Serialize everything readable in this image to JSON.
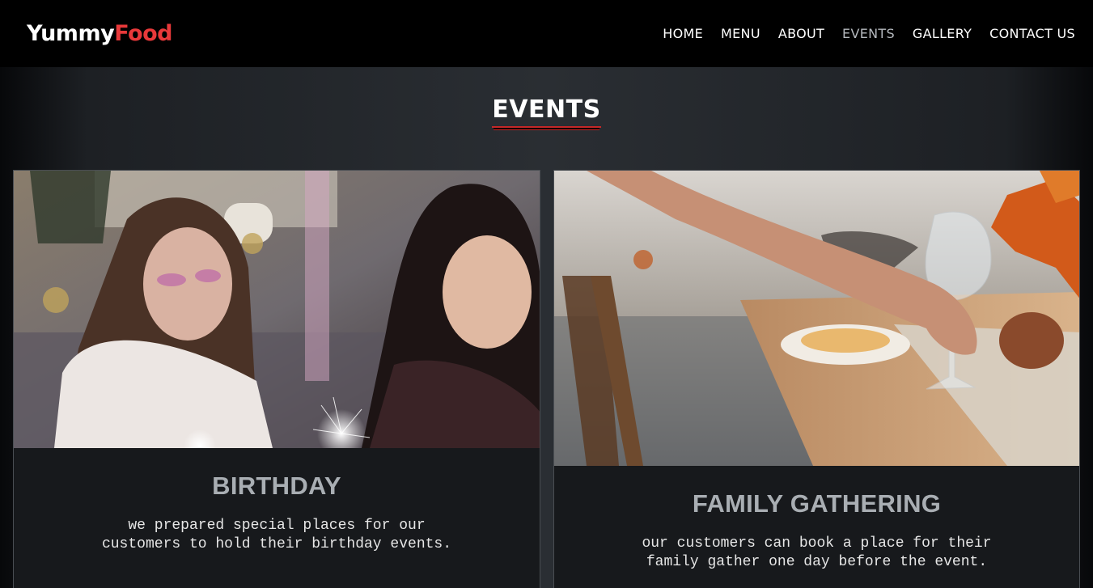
{
  "brand": {
    "part1": "Yummy",
    "part2": "Food"
  },
  "nav": {
    "items": [
      {
        "label": "HOME"
      },
      {
        "label": "MENU"
      },
      {
        "label": "ABOUT"
      },
      {
        "label": "EVENTS",
        "active": true
      },
      {
        "label": "GALLERY"
      },
      {
        "label": "CONTACT US"
      }
    ]
  },
  "section": {
    "title": "EVENTS"
  },
  "events": [
    {
      "title": "BIRTHDAY",
      "text": "we prepared special places for our customers to hold their birthday events.",
      "image": "birthday-party-photo"
    },
    {
      "title": "FAMILY GATHERING",
      "text": "our customers can book a place for their family gather one day before the event.",
      "image": "family-table-setting-photo"
    }
  ],
  "colors": {
    "brand_accent": "#e8393a",
    "underline": "#c62828",
    "card_bg": "#17191c"
  }
}
